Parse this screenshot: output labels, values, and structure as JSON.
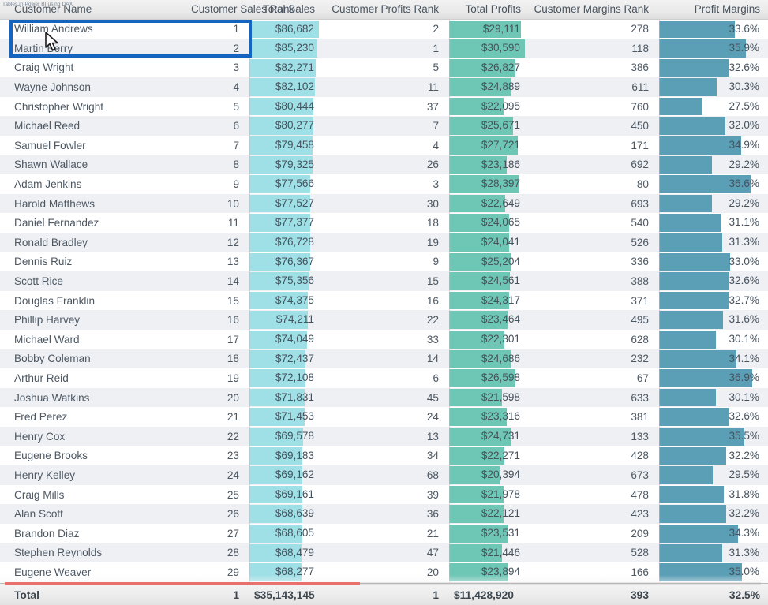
{
  "watermark": "Tables in Power BI using DAX",
  "table": {
    "columns": [
      {
        "key": "customer_name",
        "label": "Customer Name",
        "align": "left"
      },
      {
        "key": "customer_sales_rank",
        "label": "Customer Sales Rank",
        "align": "right"
      },
      {
        "key": "total_sales",
        "label": "Total Sales",
        "align": "right"
      },
      {
        "key": "customer_profits_rank",
        "label": "Customer Profits Rank",
        "align": "right"
      },
      {
        "key": "total_profits",
        "label": "Total Profits",
        "align": "right"
      },
      {
        "key": "customer_margins_rank",
        "label": "Customer Margins Rank",
        "align": "right"
      },
      {
        "key": "profit_margins",
        "label": "Profit Margins",
        "align": "right"
      }
    ],
    "rows": [
      {
        "name": "William Andrews",
        "sales_rank": "1",
        "total_sales": "$86,682",
        "sales_pct": 100,
        "profits_rank": "2",
        "total_profits": "$29,111",
        "profits_pct": 95,
        "margins_rank": "278",
        "profit_margins": "33.6%",
        "margins_pct": 72
      },
      {
        "name": "Martin Berry",
        "sales_rank": "2",
        "total_sales": "$85,230",
        "sales_pct": 98,
        "profits_rank": "1",
        "total_profits": "$30,590",
        "profits_pct": 100,
        "margins_pct": 83,
        "margins_rank": "118",
        "profit_margins": "35.9%"
      },
      {
        "name": "Craig Wright",
        "sales_rank": "3",
        "total_sales": "$82,271",
        "sales_pct": 95,
        "profits_rank": "5",
        "total_profits": "$26,827",
        "profits_pct": 88,
        "margins_rank": "386",
        "profit_margins": "32.6%",
        "margins_pct": 66
      },
      {
        "name": "Wayne Johnson",
        "sales_rank": "4",
        "total_sales": "$82,102",
        "sales_pct": 94,
        "profits_rank": "11",
        "total_profits": "$24,889",
        "profits_pct": 81,
        "margins_rank": "611",
        "profit_margins": "30.3%",
        "margins_pct": 55
      },
      {
        "name": "Christopher Wright",
        "sales_rank": "5",
        "total_sales": "$80,444",
        "sales_pct": 92,
        "profits_rank": "37",
        "total_profits": "$22,095",
        "profits_pct": 72,
        "margins_rank": "760",
        "profit_margins": "27.5%",
        "margins_pct": 41
      },
      {
        "name": "Michael Reed",
        "sales_rank": "6",
        "total_sales": "$80,277",
        "sales_pct": 92,
        "profits_rank": "7",
        "total_profits": "$25,671",
        "profits_pct": 84,
        "margins_rank": "450",
        "profit_margins": "32.0%",
        "margins_pct": 63
      },
      {
        "name": "Samuel Fowler",
        "sales_rank": "7",
        "total_sales": "$79,458",
        "sales_pct": 91,
        "profits_rank": "4",
        "total_profits": "$27,721",
        "profits_pct": 91,
        "margins_rank": "171",
        "profit_margins": "34.9%",
        "margins_pct": 78
      },
      {
        "name": "Shawn Wallace",
        "sales_rank": "8",
        "total_sales": "$79,325",
        "sales_pct": 91,
        "profits_rank": "26",
        "total_profits": "$23,186",
        "profits_pct": 76,
        "margins_rank": "692",
        "profit_margins": "29.2%",
        "margins_pct": 50
      },
      {
        "name": "Adam Jenkins",
        "sales_rank": "9",
        "total_sales": "$77,566",
        "sales_pct": 88,
        "profits_rank": "3",
        "total_profits": "$28,397",
        "profits_pct": 93,
        "margins_rank": "80",
        "profit_margins": "36.6%",
        "margins_pct": 87
      },
      {
        "name": "Harold Matthews",
        "sales_rank": "10",
        "total_sales": "$77,527",
        "sales_pct": 88,
        "profits_rank": "30",
        "total_profits": "$22,649",
        "profits_pct": 74,
        "margins_rank": "693",
        "profit_margins": "29.2%",
        "margins_pct": 50
      },
      {
        "name": "Daniel Fernandez",
        "sales_rank": "11",
        "total_sales": "$77,377",
        "sales_pct": 88,
        "profits_rank": "18",
        "total_profits": "$24,065",
        "profits_pct": 79,
        "margins_rank": "540",
        "profit_margins": "31.1%",
        "margins_pct": 59
      },
      {
        "name": "Ronald Bradley",
        "sales_rank": "12",
        "total_sales": "$76,728",
        "sales_pct": 87,
        "profits_rank": "19",
        "total_profits": "$24,041",
        "profits_pct": 79,
        "margins_rank": "526",
        "profit_margins": "31.3%",
        "margins_pct": 60
      },
      {
        "name": "Dennis Ruiz",
        "sales_rank": "13",
        "total_sales": "$76,367",
        "sales_pct": 87,
        "profits_rank": "9",
        "total_profits": "$25,204",
        "profits_pct": 82,
        "margins_rank": "336",
        "profit_margins": "33.0%",
        "margins_pct": 68
      },
      {
        "name": "Scott Rice",
        "sales_rank": "14",
        "total_sales": "$75,356",
        "sales_pct": 85,
        "profits_rank": "15",
        "total_profits": "$24,561",
        "profits_pct": 80,
        "margins_rank": "388",
        "profit_margins": "32.6%",
        "margins_pct": 66
      },
      {
        "name": "Douglas Franklin",
        "sales_rank": "15",
        "total_sales": "$74,375",
        "sales_pct": 84,
        "profits_rank": "16",
        "total_profits": "$24,317",
        "profits_pct": 79,
        "margins_rank": "371",
        "profit_margins": "32.7%",
        "margins_pct": 67
      },
      {
        "name": "Phillip Harvey",
        "sales_rank": "16",
        "total_sales": "$74,211",
        "sales_pct": 84,
        "profits_rank": "22",
        "total_profits": "$23,464",
        "profits_pct": 77,
        "margins_rank": "495",
        "profit_margins": "31.6%",
        "margins_pct": 61
      },
      {
        "name": "Michael Ward",
        "sales_rank": "17",
        "total_sales": "$74,049",
        "sales_pct": 83,
        "profits_rank": "33",
        "total_profits": "$22,301",
        "profits_pct": 73,
        "margins_rank": "628",
        "profit_margins": "30.1%",
        "margins_pct": 54
      },
      {
        "name": "Bobby Coleman",
        "sales_rank": "18",
        "total_sales": "$72,437",
        "sales_pct": 81,
        "profits_rank": "14",
        "total_profits": "$24,686",
        "profits_pct": 81,
        "margins_rank": "232",
        "profit_margins": "34.1%",
        "margins_pct": 74
      },
      {
        "name": "Arthur Reid",
        "sales_rank": "19",
        "total_sales": "$72,108",
        "sales_pct": 81,
        "profits_rank": "6",
        "total_profits": "$26,598",
        "profits_pct": 87,
        "margins_rank": "67",
        "profit_margins": "36.9%",
        "margins_pct": 89
      },
      {
        "name": "Joshua Watkins",
        "sales_rank": "20",
        "total_sales": "$71,831",
        "sales_pct": 80,
        "profits_rank": "45",
        "total_profits": "$21,598",
        "profits_pct": 70,
        "margins_rank": "633",
        "profit_margins": "30.1%",
        "margins_pct": 54
      },
      {
        "name": "Fred Perez",
        "sales_rank": "21",
        "total_sales": "$71,453",
        "sales_pct": 80,
        "profits_rank": "24",
        "total_profits": "$23,316",
        "profits_pct": 76,
        "margins_rank": "381",
        "profit_margins": "32.6%",
        "margins_pct": 66
      },
      {
        "name": "Henry Cox",
        "sales_rank": "22",
        "total_sales": "$69,578",
        "sales_pct": 77,
        "profits_rank": "13",
        "total_profits": "$24,731",
        "profits_pct": 81,
        "margins_rank": "133",
        "profit_margins": "35.5%",
        "margins_pct": 81
      },
      {
        "name": "Eugene Brooks",
        "sales_rank": "23",
        "total_sales": "$69,183",
        "sales_pct": 76,
        "profits_rank": "34",
        "total_profits": "$22,271",
        "profits_pct": 73,
        "margins_rank": "428",
        "profit_margins": "32.2%",
        "margins_pct": 64
      },
      {
        "name": "Henry Kelley",
        "sales_rank": "24",
        "total_sales": "$69,162",
        "sales_pct": 76,
        "profits_rank": "68",
        "total_profits": "$20,394",
        "profits_pct": 67,
        "margins_rank": "673",
        "profit_margins": "29.5%",
        "margins_pct": 51
      },
      {
        "name": "Craig Mills",
        "sales_rank": "25",
        "total_sales": "$69,161",
        "sales_pct": 76,
        "profits_rank": "39",
        "total_profits": "$21,978",
        "profits_pct": 72,
        "margins_rank": "478",
        "profit_margins": "31.8%",
        "margins_pct": 62
      },
      {
        "name": "Alan Scott",
        "sales_rank": "26",
        "total_sales": "$68,639",
        "sales_pct": 76,
        "profits_rank": "36",
        "total_profits": "$22,121",
        "profits_pct": 72,
        "margins_rank": "423",
        "profit_margins": "32.2%",
        "margins_pct": 64
      },
      {
        "name": "Brandon Diaz",
        "sales_rank": "27",
        "total_sales": "$68,605",
        "sales_pct": 76,
        "profits_rank": "21",
        "total_profits": "$23,531",
        "profits_pct": 77,
        "margins_rank": "209",
        "profit_margins": "34.3%",
        "margins_pct": 75
      },
      {
        "name": "Stephen Reynolds",
        "sales_rank": "28",
        "total_sales": "$68,479",
        "sales_pct": 75,
        "profits_rank": "47",
        "total_profits": "$21,446",
        "profits_pct": 70,
        "margins_rank": "528",
        "profit_margins": "31.3%",
        "margins_pct": 60
      },
      {
        "name": "Eugene Weaver",
        "sales_rank": "29",
        "total_sales": "$68,277",
        "sales_pct": 75,
        "profits_rank": "20",
        "total_profits": "$23,894",
        "profits_pct": 78,
        "margins_rank": "166",
        "profit_margins": "35.0%",
        "margins_pct": 79
      }
    ],
    "total": {
      "label": "Total",
      "sales_rank": "1",
      "total_sales": "$35,143,145",
      "profits_rank": "1",
      "total_profits": "$11,428,920",
      "margins_rank": "393",
      "profit_margins": "32.5%"
    }
  },
  "selection": {
    "row_name": "William Andrews",
    "outline_color": "#1565c0"
  },
  "colors": {
    "sales_bar": "#9fe0e6",
    "profits_bar": "#6ec7b4",
    "margins_bar": "#5a9fb6",
    "scrub_progress": "#e8716d"
  },
  "player": {
    "progress_pct": 47
  }
}
